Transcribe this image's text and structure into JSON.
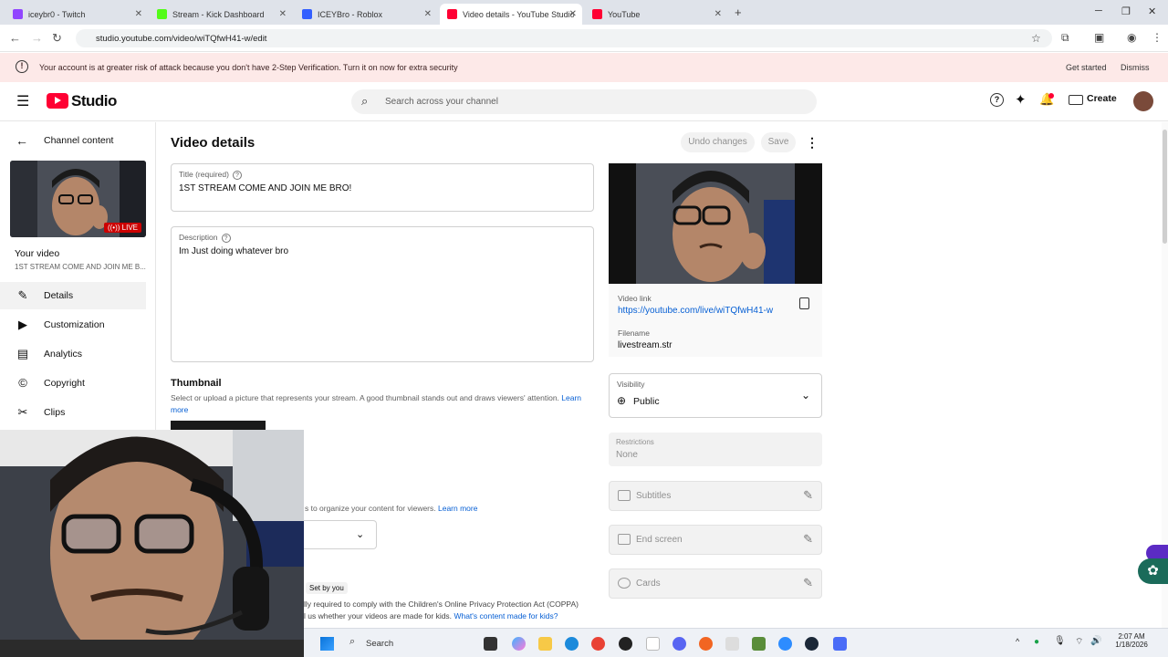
{
  "browser": {
    "tabs": [
      {
        "title": "iceybr0 - Twitch",
        "color": "#9146ff",
        "active": false
      },
      {
        "title": "Stream - Kick Dashboard",
        "color": "#2e2e2e",
        "active": false
      },
      {
        "title": "ICEYBro - Roblox",
        "color": "#335fff",
        "active": false
      },
      {
        "title": "Video details - YouTube Studio",
        "color": "#ff0033",
        "active": true
      },
      {
        "title": "YouTube",
        "color": "#ff0033",
        "active": false
      }
    ],
    "url": "studio.youtube.com/video/wiTQfwH41-w/edit"
  },
  "banner": {
    "message": "Your account is at greater risk of attack because you don't have 2-Step Verification. Turn it on now for extra security",
    "get_started": "Get started",
    "dismiss": "Dismiss"
  },
  "header": {
    "logo": "Studio",
    "search_placeholder": "Search across your channel",
    "create_label": "Create"
  },
  "sidebar": {
    "back_label": "Channel content",
    "live_badge": "LIVE",
    "your_video_label": "Your video",
    "video_title_short": "1ST STREAM COME AND JOIN ME B...",
    "items": [
      {
        "label": "Details",
        "icon": "pencil-icon"
      },
      {
        "label": "Customization",
        "icon": "customization-icon"
      },
      {
        "label": "Analytics",
        "icon": "analytics-icon"
      },
      {
        "label": "Copyright",
        "icon": "copyright-icon"
      },
      {
        "label": "Clips",
        "icon": "scissors-icon"
      }
    ]
  },
  "main": {
    "page_title": "Video details",
    "undo_label": "Undo changes",
    "save_label": "Save",
    "title_label": "Title (required)",
    "title_value": "1ST STREAM COME AND JOIN ME BRO!",
    "description_label": "Description",
    "description_value": "Im Just doing whatever bro",
    "thumbnail_heading": "Thumbnail",
    "thumbnail_desc": "Select or upload a picture that represents your stream. A good thumbnail stands out and draws viewers' attention.",
    "learn_more": "Learn more",
    "playlist_desc_partial": "s to organize your content for viewers.",
    "playlist_learn_more": "Learn more",
    "set_by_you": "Set by you",
    "coppa_line1": "lly required to comply with the Children's Online Privacy Protection Act (COPPA)",
    "coppa_line2": "l us whether your videos are made for kids.",
    "coppa_link": "What's content made for kids?"
  },
  "right": {
    "video_link_label": "Video link",
    "video_link": "https://youtube.com/live/wiTQfwH41-w",
    "filename_label": "Filename",
    "filename": "livestream.str",
    "visibility_label": "Visibility",
    "visibility_value": "Public",
    "restrictions_label": "Restrictions",
    "restrictions_value": "None",
    "subtitles": "Subtitles",
    "end_screen": "End screen",
    "cards": "Cards"
  },
  "taskbar": {
    "search_label": "Search",
    "time": "2:07 AM",
    "date": "1/18/2026"
  }
}
